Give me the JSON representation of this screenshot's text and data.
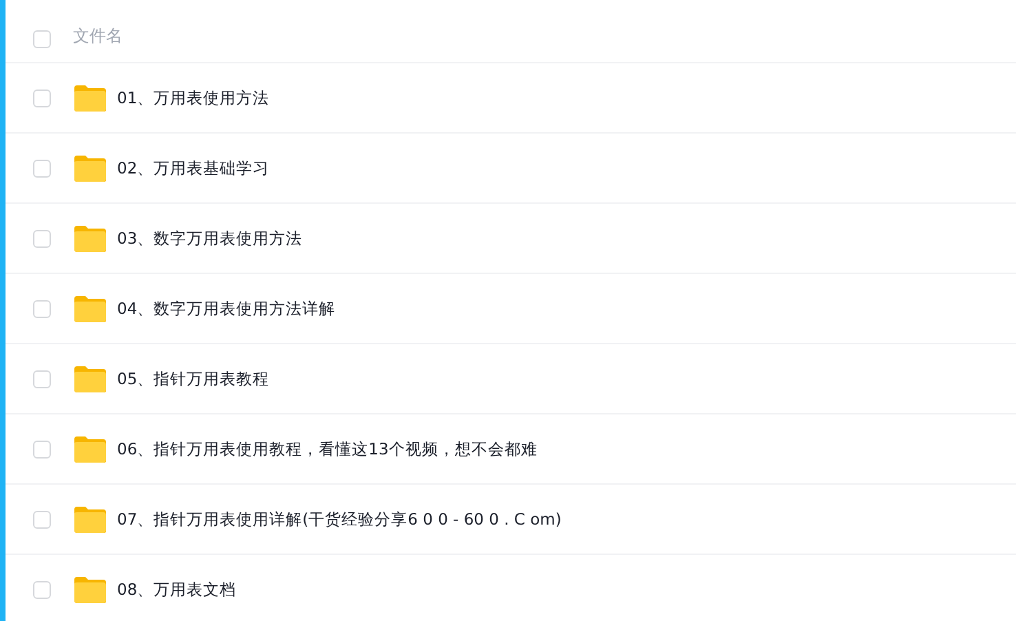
{
  "header": {
    "label": "文件名",
    "checked": false
  },
  "files": [
    {
      "name": "01、万用表使用方法",
      "checked": false
    },
    {
      "name": "02、万用表基础学习",
      "checked": false
    },
    {
      "name": "03、数字万用表使用方法",
      "checked": false
    },
    {
      "name": "04、数字万用表使用方法详解",
      "checked": false
    },
    {
      "name": "05、指针万用表教程",
      "checked": false
    },
    {
      "name": "06、指针万用表使用教程，看懂这13个视频，想不会都难",
      "checked": false
    },
    {
      "name": "07、指针万用表使用详解(干货经验分享6 0 0 - 60 0 . C om)",
      "checked": false
    },
    {
      "name": "08、万用表文档",
      "checked": false
    }
  ]
}
